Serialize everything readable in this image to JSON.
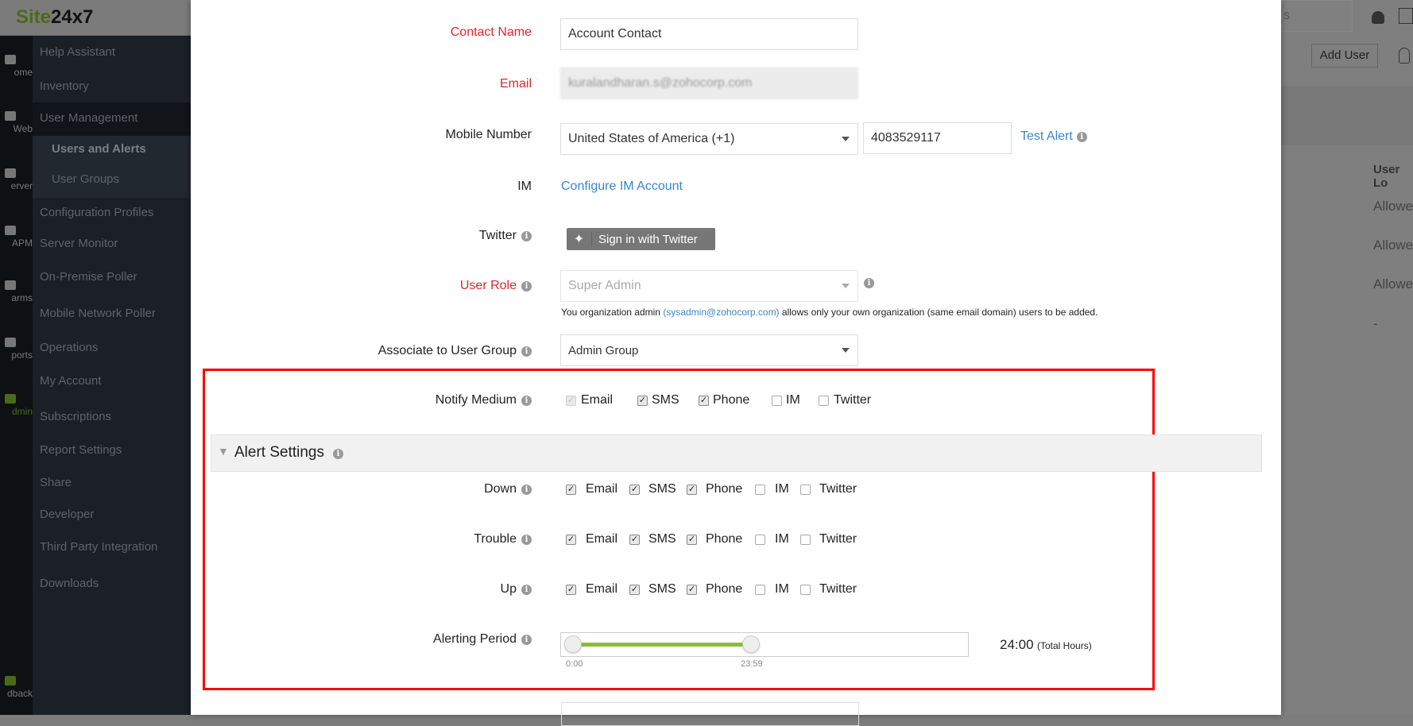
{
  "app": {
    "logo_a": "Site",
    "logo_b": "24x7",
    "search_partial": "s"
  },
  "rail": [
    "ome",
    "Web",
    "erver",
    "APM",
    "arms",
    "ports",
    "dmin",
    "dback"
  ],
  "menu": {
    "items": [
      "Help Assistant",
      "Inventory",
      "User Management",
      "Users and Alerts",
      "User Groups",
      "Configuration Profiles",
      "Server Monitor",
      "On-Premise Poller",
      "Mobile Network Poller",
      "Operations",
      "My Account",
      "Subscriptions",
      "Report Settings",
      "Share",
      "Developer",
      "Third Party Integration",
      "Downloads"
    ]
  },
  "right": {
    "add_user": "Add User",
    "col_header": "User Lo",
    "rows": [
      "Allowe",
      "Allowe",
      "Allowe",
      "-"
    ]
  },
  "form": {
    "contact_name": {
      "label": "Contact Name",
      "value": "Account Contact"
    },
    "email": {
      "label": "Email",
      "value": "kuralandharan.s@zohocorp.com"
    },
    "mobile": {
      "label": "Mobile Number",
      "country": "United States of America (+1)",
      "number": "4083529117",
      "test_alert": "Test Alert"
    },
    "im": {
      "label": "IM",
      "link": "Configure IM Account"
    },
    "twitter": {
      "label": "Twitter",
      "button": "Sign in with Twitter"
    },
    "user_role": {
      "label": "User Role",
      "value": "Super Admin",
      "note_a": "You organization admin ",
      "note_email": "(sysadmin@zohocorp.com)",
      "note_b": " allows only your own organization (same email domain) users to be added."
    },
    "user_group": {
      "label": "Associate to User Group",
      "value": "Admin Group"
    },
    "notify": {
      "label": "Notify Medium",
      "options": [
        "Email",
        "SMS",
        "Phone",
        "IM",
        "Twitter"
      ],
      "checked": [
        true,
        true,
        true,
        false,
        false
      ]
    },
    "alert_settings": {
      "title": "Alert Settings",
      "rows": [
        {
          "label": "Down",
          "checked": [
            true,
            true,
            true,
            false,
            false
          ]
        },
        {
          "label": "Trouble",
          "checked": [
            true,
            true,
            true,
            false,
            false
          ]
        },
        {
          "label": "Up",
          "checked": [
            true,
            true,
            true,
            false,
            false
          ]
        }
      ],
      "options": [
        "Email",
        "SMS",
        "Phone",
        "IM",
        "Twitter"
      ]
    },
    "alerting_period": {
      "label": "Alerting Period",
      "start": "0:00",
      "end": "23:59",
      "total": "24:00",
      "total_unit": "(Total Hours)",
      "start_fraction": 0,
      "end_fraction": 0.465,
      "color": "#8dbb3a"
    }
  }
}
